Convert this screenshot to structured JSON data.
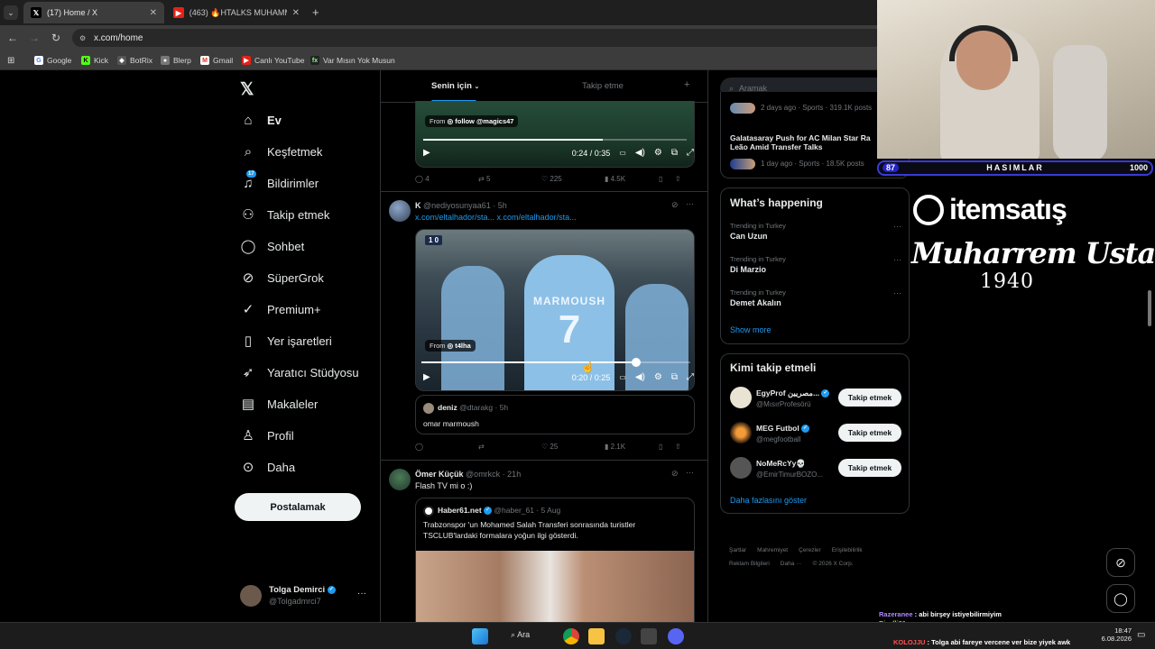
{
  "browser": {
    "tabs": [
      {
        "label": "(17) Home / X"
      },
      {
        "label": "(463) 🔥HTALKS MUHAMMED"
      }
    ],
    "url": "x.com/home",
    "bookmarks": [
      "Google",
      "Kick",
      "BotRix",
      "Blerp",
      "Gmail",
      "Canlı YouTube",
      "Var Mısın Yok Musun"
    ]
  },
  "nav": {
    "items": [
      {
        "label": "Ev",
        "icon": "home-icon"
      },
      {
        "label": "Keşfetmek",
        "icon": "search-icon"
      },
      {
        "label": "Bildirimler",
        "icon": "bell-icon",
        "badge": "17"
      },
      {
        "label": "Takip etmek",
        "icon": "person-add-icon"
      },
      {
        "label": "Sohbet",
        "icon": "chat-icon"
      },
      {
        "label": "SüperGrok",
        "icon": "grok-icon"
      },
      {
        "label": "Premium+",
        "icon": "verified-icon"
      },
      {
        "label": "Yer işaretleri",
        "icon": "bookmark-icon"
      },
      {
        "label": "Yaratıcı Stüdyosu",
        "icon": "rocket-icon"
      },
      {
        "label": "Makaleler",
        "icon": "article-icon"
      },
      {
        "label": "Profil",
        "icon": "profile-icon"
      },
      {
        "label": "Daha",
        "icon": "more-circle-icon"
      }
    ],
    "post_label": "Postalamak",
    "account": {
      "name": "Tolga Demirci",
      "handle": "@Tolgadmrci7"
    }
  },
  "feed": {
    "tabs": [
      "Senin için",
      "Takip etme"
    ],
    "post0": {
      "from_label": "From",
      "from_name": "follow @magics47",
      "time": "0:24 / 0:35",
      "replies": "4",
      "reposts": "5",
      "likes": "225",
      "views": "4.5K"
    },
    "post1": {
      "name": "K",
      "handle": "@nediyosunyaa61 · 5h",
      "link": "x.com/eltalhador/sta... x.com/eltalhador/sta...",
      "scoreboard": "1 0",
      "jersey_name": "MARMOUSH",
      "jersey_number": "7",
      "from_label": "From",
      "from_name": "t4lha",
      "time": "0:20 / 0:25",
      "progress": 0.8,
      "quote": {
        "name": "deniz",
        "handle": "@dtarakg · 5h",
        "text": "omar marmoush"
      },
      "replies": "",
      "reposts": "",
      "likes": "25",
      "views": "2.1K"
    },
    "post2": {
      "name": "Ömer Küçük",
      "handle": "@omrkck · 21h",
      "text": "Flash TV mi o :)",
      "quote": {
        "name": "Haber61.net",
        "handle": "@haber_61 · 5 Aug",
        "text_line1": "Trabzonspor 'un Mohamed Salah Transferi sonrasında turistler",
        "text_line2": "TSCLUB'lardaki formalara yoğun ilgi gösterdi."
      }
    }
  },
  "right": {
    "search_placeholder": "Aramak",
    "news": [
      {
        "meta": "2 days ago · Sports · 319.1K posts"
      },
      {
        "title_line1": "Galatasaray Push for AC Milan Star Ra",
        "title_line2": "Leão Amid Transfer Talks",
        "meta": "1 day ago · Sports · 18.5K posts"
      }
    ],
    "happening_title": "What’s happening",
    "trends": [
      {
        "context": "Trending in Turkey",
        "name": "Can Uzun"
      },
      {
        "context": "Trending in Turkey",
        "name": "Di Marzio"
      },
      {
        "context": "Trending in Turkey",
        "name": "Demet Akalın"
      }
    ],
    "show_more": "Show more",
    "who_title": "Kimi takip etmeli",
    "who": [
      {
        "name": "EgyProf مصريين...",
        "handle": "@MısırProfesörü",
        "button": "Takip etmek"
      },
      {
        "name": "MEG Futbol",
        "handle": "@megfootball",
        "button": "Takip etmek"
      },
      {
        "name": "NoMeRcYy💀",
        "handle": "@EmirTimurBOZO...",
        "button": "Takip etmek"
      }
    ],
    "who_more": "Daha fazlasını göster",
    "footer_line1": [
      "Şartlar",
      "Mahremiyet",
      "Çerezler",
      "Erişilebilirlik"
    ],
    "footer_line2": [
      "Reklam Bilgileri",
      "Daha ···",
      "© 2026 X Corp."
    ]
  },
  "overlay": {
    "bar_left": "87",
    "bar_title": "HASIMLAR",
    "bar_right": "1000",
    "brand": "itemsatış",
    "signature": "Muharrem Usta",
    "year": "1940",
    "chat": [
      {
        "user": "Razeranee",
        "msg": "abi birşey istiyebilirmiyim"
      },
      {
        "user": "Birofli61",
        "msg": ""
      },
      {
        "user": "KOLOJJU",
        "msg": "Tolga abi fareye vercene ver bize yiyek awk"
      }
    ]
  },
  "taskbar": {
    "search": "Ara",
    "time": "18:47",
    "date": "6.08.2026"
  },
  "colors": {
    "accent": "#1d9bf0",
    "bg": "#000000",
    "border": "#2f3336",
    "muted": "#71767b"
  }
}
